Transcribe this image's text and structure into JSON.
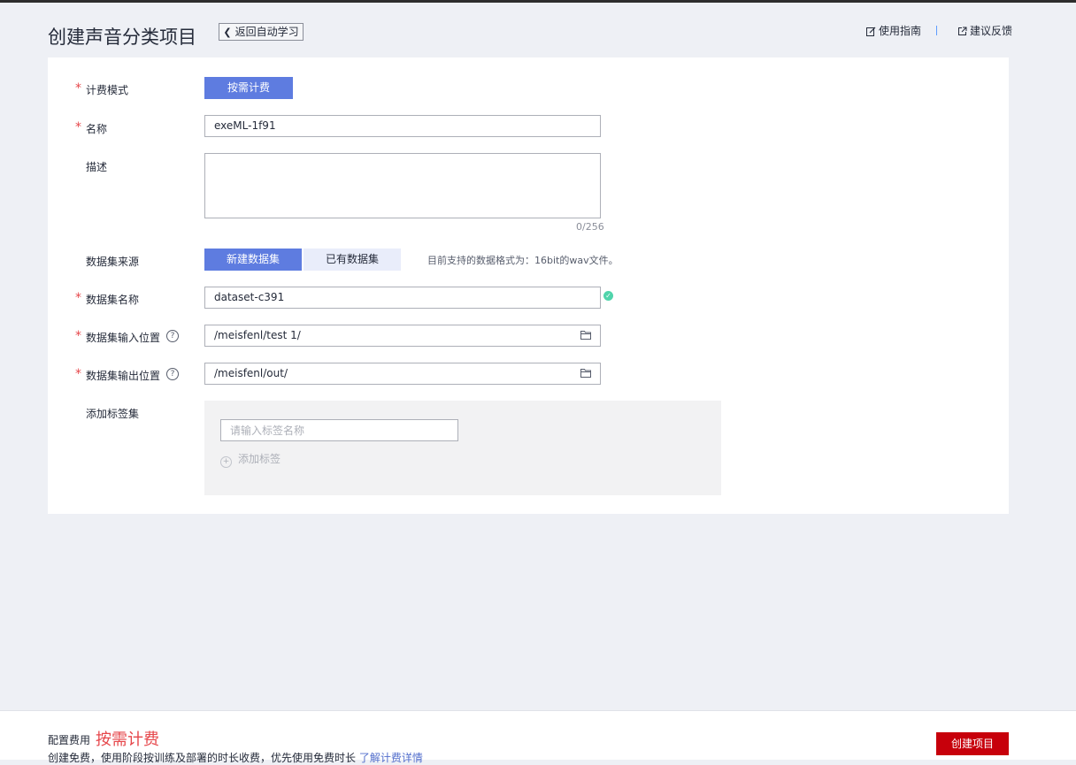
{
  "header": {
    "title": "创建声音分类项目",
    "back_label": "返回自动学习",
    "guide_label": "使用指南",
    "feedback_label": "建议反馈"
  },
  "form": {
    "billing": {
      "label": "计费模式",
      "value": "按需计费"
    },
    "name": {
      "label": "名称",
      "value": "exeML-1f91"
    },
    "description": {
      "label": "描述",
      "value": "",
      "counter": "0/256"
    },
    "dataset_source": {
      "label": "数据集来源",
      "options": [
        "新建数据集",
        "已有数据集"
      ],
      "selected": "新建数据集",
      "hint": "目前支持的数据格式为：16bit的wav文件。"
    },
    "dataset_name": {
      "label": "数据集名称",
      "value": "dataset-c391"
    },
    "input_path": {
      "label": "数据集输入位置",
      "value": "/meisfenl/test 1/"
    },
    "output_path": {
      "label": "数据集输出位置",
      "value": "/meisfenl/out/"
    },
    "tags": {
      "label": "添加标签集",
      "placeholder": "请输入标签名称",
      "add_label": "添加标签"
    }
  },
  "footer": {
    "fee_label": "配置费用",
    "fee_value": "按需计费",
    "note_text": "创建免费，使用阶段按训练及部署的时长收费，优先使用免费时长",
    "note_link": "了解计费详情",
    "create_label": "创建项目"
  },
  "colors": {
    "primary": "#5e7ce0",
    "danger": "#c7000b",
    "required": "#e6474b",
    "success": "#50d4ab"
  }
}
